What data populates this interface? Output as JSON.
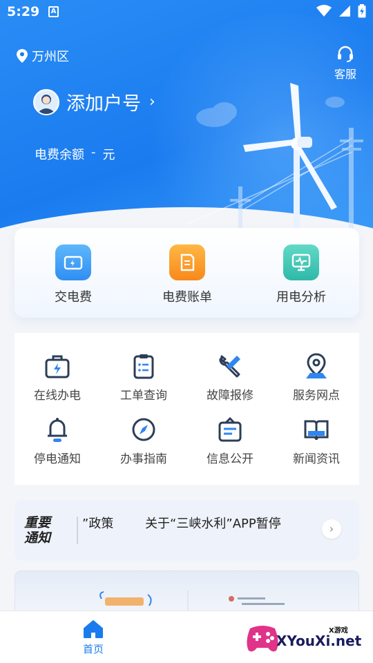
{
  "status_bar": {
    "time": "5:29",
    "notification_icon": "A"
  },
  "header": {
    "location": "万州区",
    "service_label": "客服",
    "account_label": "添加户号",
    "balance_label": "电费余额",
    "balance_value": "-",
    "balance_unit": "元"
  },
  "main_actions": [
    {
      "label": "交电费",
      "icon": "wallet-icon",
      "color": "#3aa0f6"
    },
    {
      "label": "电费账单",
      "icon": "bill-icon",
      "color": "#f99a1c"
    },
    {
      "label": "用电分析",
      "icon": "monitor-icon",
      "color": "#39c7b5"
    }
  ],
  "services": [
    {
      "label": "在线办电",
      "icon": "toolbox-icon"
    },
    {
      "label": "工单查询",
      "icon": "clipboard-icon"
    },
    {
      "label": "故障报修",
      "icon": "tools-icon"
    },
    {
      "label": "服务网点",
      "icon": "location-pin-icon"
    },
    {
      "label": "停电通知",
      "icon": "bell-icon"
    },
    {
      "label": "办事指南",
      "icon": "compass-icon"
    },
    {
      "label": "信息公开",
      "icon": "info-board-icon"
    },
    {
      "label": "新闻资讯",
      "icon": "book-icon"
    }
  ],
  "notice": {
    "tag_line1": "重要",
    "tag_line2": "通知",
    "text_1": "”政策",
    "text_2": "关于“三峡水利”APP暂停"
  },
  "tabbar": {
    "home_label": "首页"
  },
  "watermark": {
    "text": "XYouXi.net",
    "small": "X游戏"
  },
  "colors": {
    "primary": "#1a7bef",
    "icon_dark": "#2c3e57",
    "icon_accent": "#2f86f0"
  }
}
